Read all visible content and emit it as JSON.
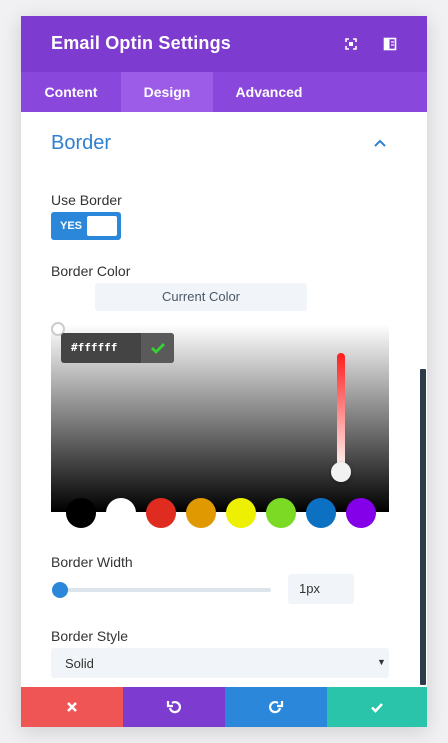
{
  "header": {
    "title": "Email Optin Settings",
    "icons": [
      "expand-icon",
      "sidebar-layout-icon"
    ]
  },
  "tabs": [
    {
      "label": "Content",
      "active": false
    },
    {
      "label": "Design",
      "active": true
    },
    {
      "label": "Advanced",
      "active": false
    }
  ],
  "section": {
    "title": "Border",
    "expanded": true
  },
  "use_border": {
    "label": "Use Border",
    "toggle_label": "YES",
    "value": true
  },
  "border_color": {
    "label": "Border Color",
    "current_color_label": "Current Color",
    "hex_value": "#ffffff",
    "swatches": [
      {
        "name": "black",
        "color": "#000000"
      },
      {
        "name": "white",
        "color": "#ffffff"
      },
      {
        "name": "red",
        "color": "#e02b20"
      },
      {
        "name": "orange",
        "color": "#e09900"
      },
      {
        "name": "yellow",
        "color": "#edf000"
      },
      {
        "name": "green",
        "color": "#7cda24"
      },
      {
        "name": "blue",
        "color": "#0c71c3"
      },
      {
        "name": "purple",
        "color": "#8300e9"
      }
    ]
  },
  "border_width": {
    "label": "Border Width",
    "value": "1px"
  },
  "border_style": {
    "label": "Border Style",
    "value": "Solid"
  },
  "footer": {
    "buttons": [
      "cancel-icon",
      "undo-icon",
      "redo-icon",
      "save-icon"
    ]
  },
  "colors": {
    "header": "#7e3bd0",
    "tabs": "#8a47db",
    "active_tab": "#9c5ce8",
    "accent": "#2b87da",
    "title": "#2e80d1",
    "cancel": "#ef5555",
    "undo": "#7e3bd0",
    "redo": "#2b87da",
    "save": "#29c4a9"
  }
}
